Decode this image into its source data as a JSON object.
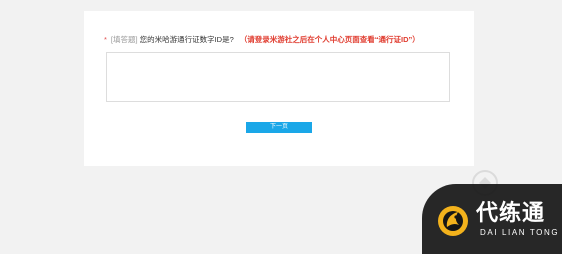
{
  "question": {
    "required_mark": "*",
    "type_label": "[填答题]",
    "text": "您的米哈游通行证数字ID是?",
    "note": "（请登录米游社之后在个人中心页面查看“通行证ID”）"
  },
  "answer": {
    "value": "",
    "placeholder": ""
  },
  "next_button": {
    "label": "下一页"
  },
  "watermark": {
    "name_cn": "代练通",
    "name_en": "DAI LIAN TONG"
  },
  "colors": {
    "page_background": "#f2f2f2",
    "card_background": "#ffffff",
    "note_red": "#e03c2f",
    "button_blue": "#1aa7e8"
  }
}
